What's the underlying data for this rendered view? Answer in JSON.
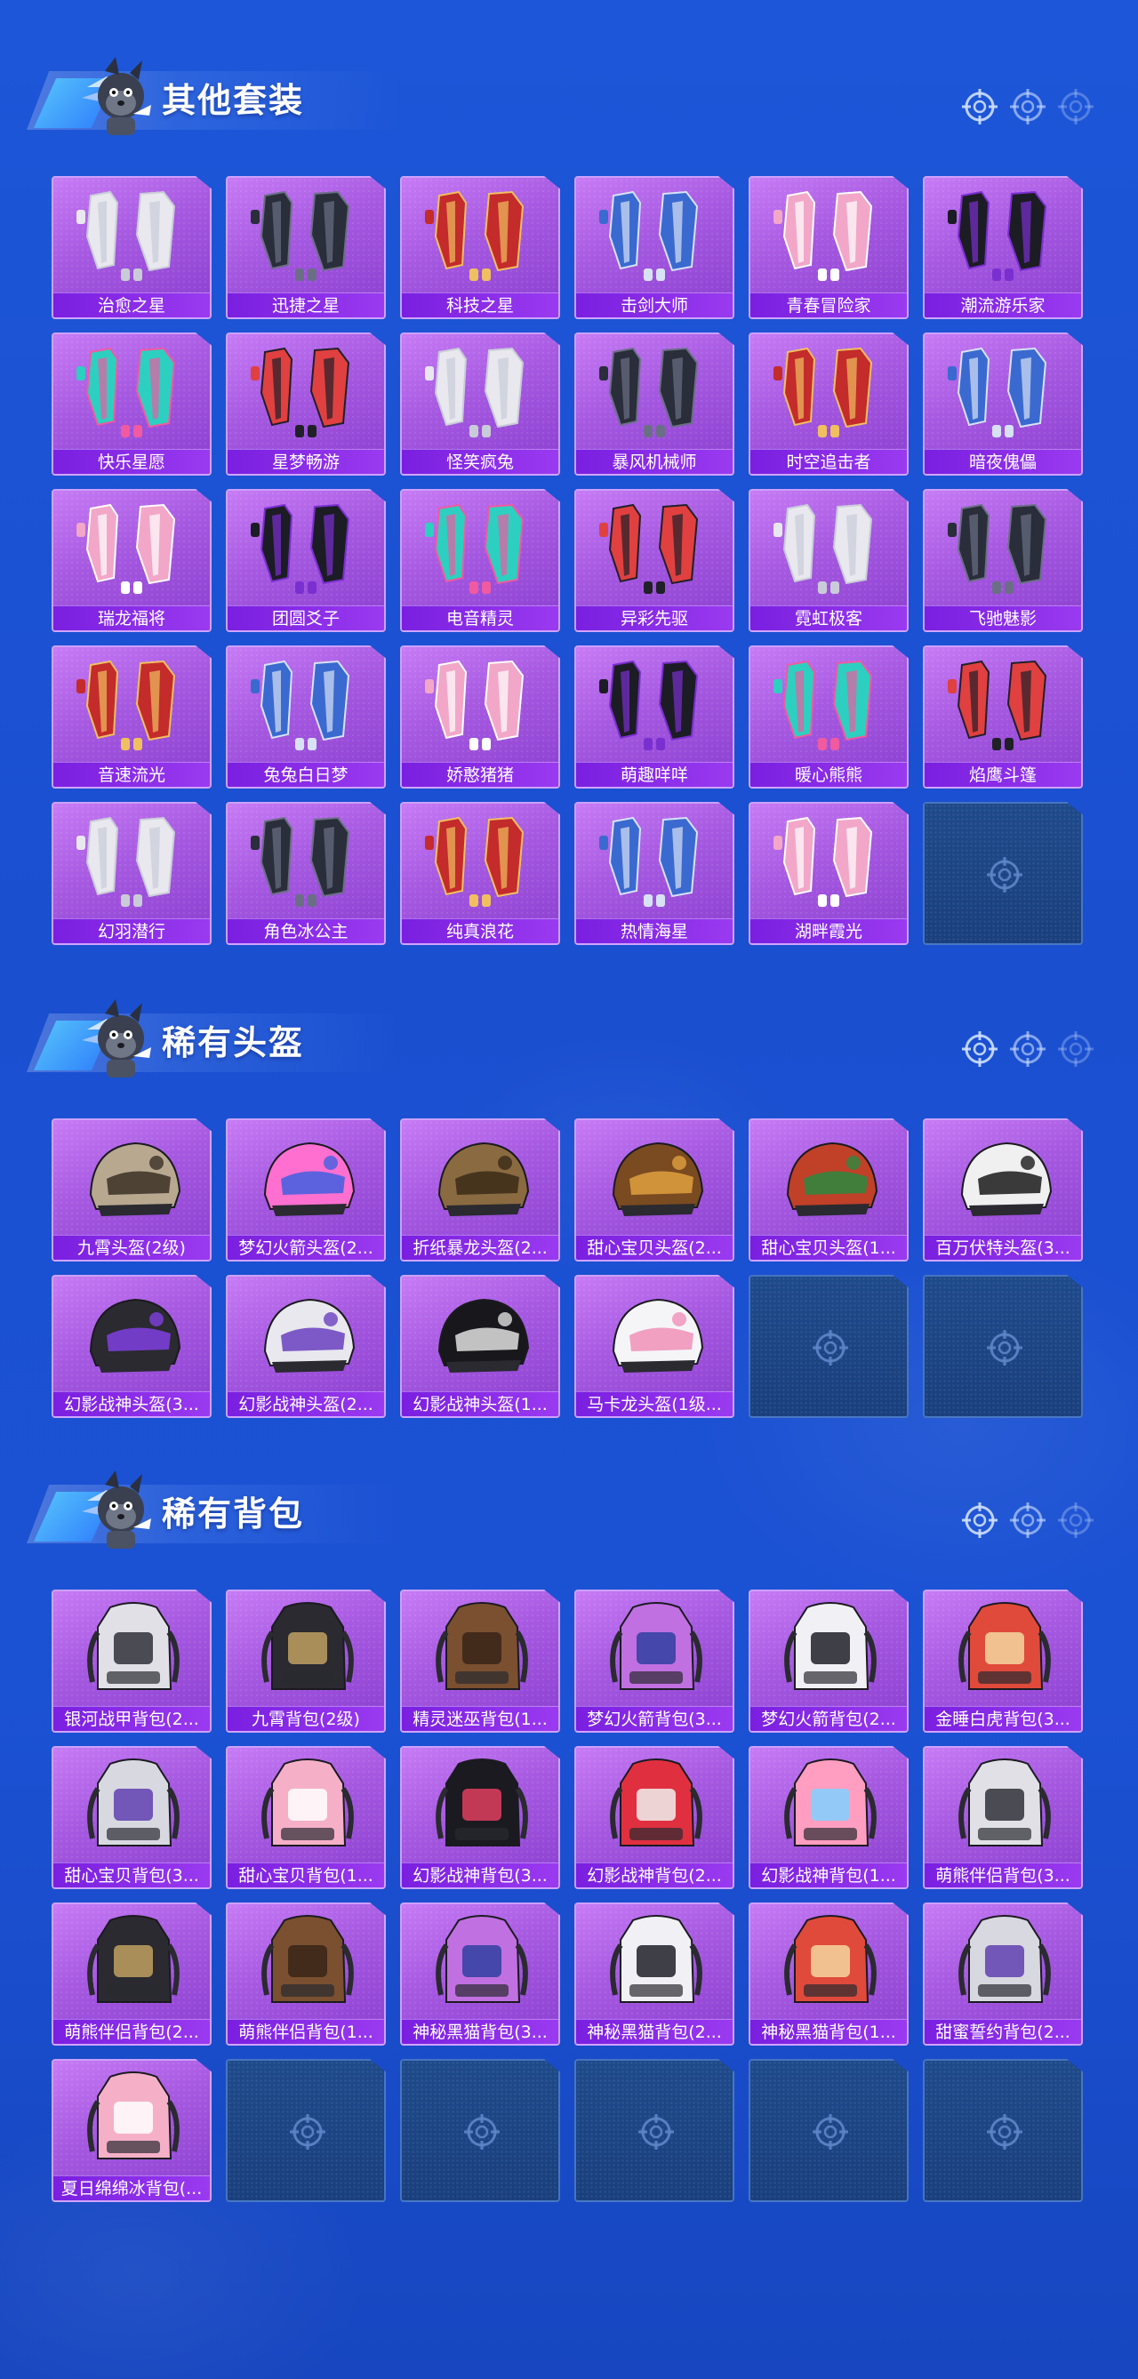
{
  "sections": [
    {
      "title": "其他套装",
      "kind": "outfit",
      "items": [
        "治愈之星",
        "迅捷之星",
        "科技之星",
        "击剑大师",
        "青春冒险家",
        "潮流游乐家",
        "快乐星愿",
        "星梦畅游",
        "怪笑疯兔",
        "暴风机械师",
        "时空追击者",
        "暗夜傀儡",
        "瑞龙福将",
        "团圆爻子",
        "电音精灵",
        "异彩先驱",
        "霓虹极客",
        "飞驰魅影",
        "音速流光",
        "兔兔白日梦",
        "娇憨猪猪",
        "萌趣咩咩",
        "暖心熊熊",
        "焰鹰斗篷",
        "幻羽潜行",
        "角色冰公主",
        "纯真浪花",
        "热情海星",
        "湖畔霞光"
      ],
      "empty_slots": 1
    },
    {
      "title": "稀有头盔",
      "kind": "helmet",
      "items": [
        "九霄头盔(2级)",
        "梦幻火箭头盔(2...",
        "折纸暴龙头盔(2...",
        "甜心宝贝头盔(2...",
        "甜心宝贝头盔(1...",
        "百万伏特头盔(3...",
        "幻影战神头盔(3...",
        "幻影战神头盔(2...",
        "幻影战神头盔(1...",
        "马卡龙头盔(1级..."
      ],
      "empty_slots": 2
    },
    {
      "title": "稀有背包",
      "kind": "backpack",
      "items": [
        "银河战甲背包(2...",
        "九霄背包(2级)",
        "精灵迷巫背包(1...",
        "梦幻火箭背包(3...",
        "梦幻火箭背包(2...",
        "金睡白虎背包(3...",
        "甜心宝贝背包(3...",
        "甜心宝贝背包(1...",
        "幻影战神背包(3...",
        "幻影战神背包(2...",
        "幻影战神背包(1...",
        "萌熊伴侣背包(3...",
        "萌熊伴侣背包(2...",
        "萌熊伴侣背包(1...",
        "神秘黑猫背包(3...",
        "神秘黑猫背包(2...",
        "神秘黑猫背包(1...",
        "甜蜜誓约背包(2...",
        "夏日绵绵冰背包(..."
      ],
      "empty_slots": 5
    }
  ],
  "icons": {
    "section_mascot": "mascot-icon",
    "header_decoration": "crosshair-icon",
    "empty_slot": "crosshair-icon"
  },
  "colors": {
    "page_bg": "#1d56d8",
    "card_bg": "#a558e0",
    "card_label_bg": "#7a1fe0",
    "empty_card_bg": "#1f4a8a"
  }
}
